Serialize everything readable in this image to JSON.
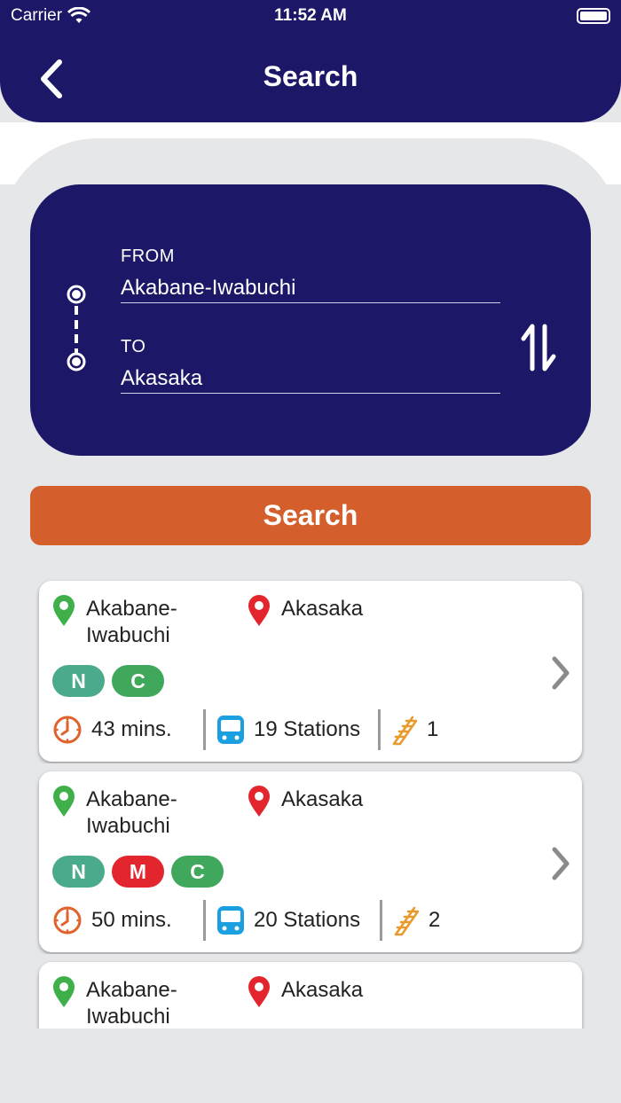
{
  "status": {
    "carrier": "Carrier",
    "time": "11:52 AM"
  },
  "nav": {
    "title": "Search",
    "back_icon": "chevron-left-icon"
  },
  "route": {
    "from_label": "FROM",
    "from_value": "Akabane-Iwabuchi",
    "to_label": "TO",
    "to_value": "Akasaka",
    "swap_icon": "swap-vertical-icon"
  },
  "search_button": "Search",
  "colors": {
    "navy": "#1c1766",
    "orange": "#d45f2d",
    "green_pin": "#3faf4a",
    "red_pin": "#e3262e",
    "line_n": "#4aab8c",
    "line_m": "#e3262e",
    "line_c": "#3fa85c",
    "clock": "#e0622c",
    "train": "#1a9fe0",
    "escalator": "#e89a2c"
  },
  "results": [
    {
      "from_line1": "Akabane-",
      "from_line2": "Iwabuchi",
      "to": "Akasaka",
      "lines": [
        "N",
        "C"
      ],
      "duration": "43 mins.",
      "stations": "19 Stations",
      "transfers": "1"
    },
    {
      "from_line1": "Akabane-",
      "from_line2": "Iwabuchi",
      "to": "Akasaka",
      "lines": [
        "N",
        "M",
        "C"
      ],
      "duration": "50 mins.",
      "stations": "20 Stations",
      "transfers": "2"
    },
    {
      "from_line1": "Akabane-",
      "from_line2": "Iwabuchi",
      "to": "Akasaka"
    }
  ]
}
